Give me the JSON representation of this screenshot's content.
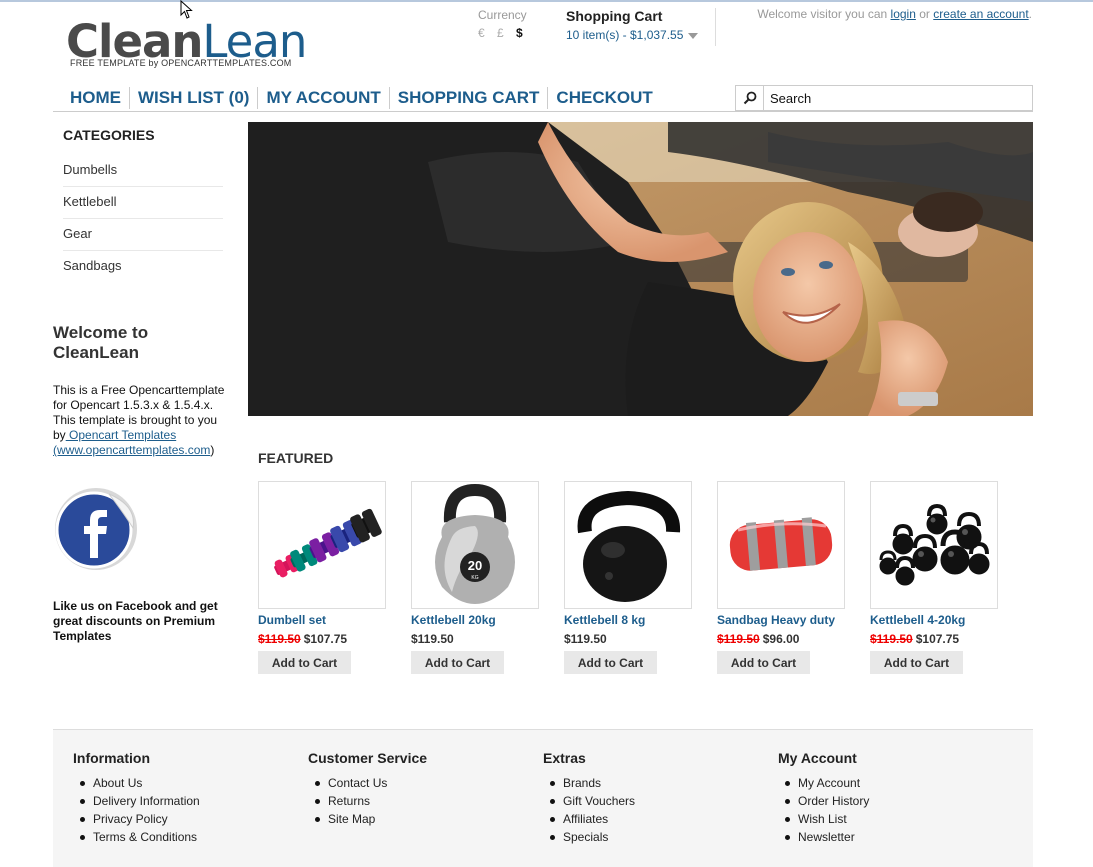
{
  "header": {
    "logo_part1": "Clean",
    "logo_part2": "Lean",
    "logo_tagline": "FREE TEMPLATE by OPENCARTTEMPLATES.COM",
    "currency_label": "Currency",
    "currency_symbols": [
      "€",
      "£",
      "$"
    ],
    "currency_active": "$",
    "cart_title": "Shopping Cart",
    "cart_summary": "10 item(s) - $1,037.55",
    "welcome_prefix": "Welcome visitor you can",
    "login_link": "login",
    "welcome_or": "or",
    "create_account_link": "create an account",
    "welcome_suffix": "."
  },
  "nav": {
    "items": [
      "HOME",
      "WISH LIST (0)",
      "MY ACCOUNT",
      "SHOPPING CART",
      "CHECKOUT"
    ],
    "search_placeholder": "Search"
  },
  "sidebar": {
    "categories_title": "CATEGORIES",
    "categories": [
      "Dumbells",
      "Kettlebell",
      "Gear",
      "Sandbags"
    ],
    "welcome_title": "Welcome to CleanLean",
    "welcome_text": "This is a Free Opencarttemplate for Opencart 1.5.3.x & 1.5.4.x. This template is brought to you by",
    "welcome_link": " Opencart Templates",
    "welcome_link2": "(www.opencarttemplates.com",
    "welcome_close": ")",
    "facebook_text": "Like us on Facebook and get great discounts on Premium Templates"
  },
  "featured": {
    "title": "FEATURED",
    "add_to_cart_label": "Add to Cart",
    "products": [
      {
        "name": "Dumbell set",
        "old_price": "$119.50",
        "price": "$107.75"
      },
      {
        "name": "Kettlebell 20kg",
        "old_price": "",
        "price": "$119.50"
      },
      {
        "name": "Kettlebell 8 kg",
        "old_price": "",
        "price": "$119.50"
      },
      {
        "name": "Sandbag Heavy duty",
        "old_price": "$119.50",
        "price": "$96.00"
      },
      {
        "name": "Kettlebell 4-20kg",
        "old_price": "$119.50",
        "price": "$107.75"
      }
    ]
  },
  "footer": {
    "columns": [
      {
        "title": "Information",
        "links": [
          "About Us",
          "Delivery Information",
          "Privacy Policy",
          "Terms & Conditions"
        ]
      },
      {
        "title": "Customer Service",
        "links": [
          "Contact Us",
          "Returns",
          "Site Map"
        ]
      },
      {
        "title": "Extras",
        "links": [
          "Brands",
          "Gift Vouchers",
          "Affiliates",
          "Specials"
        ]
      },
      {
        "title": "My Account",
        "links": [
          "My Account",
          "Order History",
          "Wish List",
          "Newsletter"
        ]
      }
    ]
  },
  "colors": {
    "link_blue": "#1d5d8c",
    "sale_red": "#e00000"
  }
}
